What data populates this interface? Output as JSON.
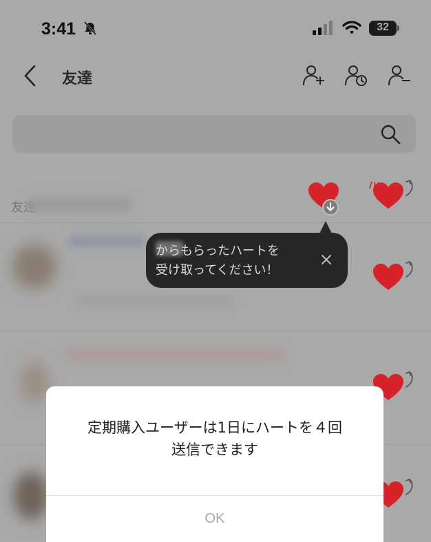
{
  "status_bar": {
    "time": "3:41",
    "battery": "32"
  },
  "header": {
    "title": "友達",
    "icons": [
      "back-chevron-icon",
      "add-friend-icon",
      "friend-history-icon",
      "remove-friend-icon"
    ]
  },
  "search": {
    "icon": "search-icon"
  },
  "list": {
    "section_label": "友達",
    "heart_color": "#d8222a"
  },
  "tooltip": {
    "text": "からもらったハートを\n受け取ってください！"
  },
  "dialog": {
    "message": "定期購入ユーザーは1日にハートを４回\n送信できます",
    "ok_label": "OK"
  },
  "colors": {
    "overlay": "#a9a9a9",
    "tooltip_bg": "#262626",
    "heart": "#d8222a",
    "ok_text": "#a8a8a8"
  }
}
